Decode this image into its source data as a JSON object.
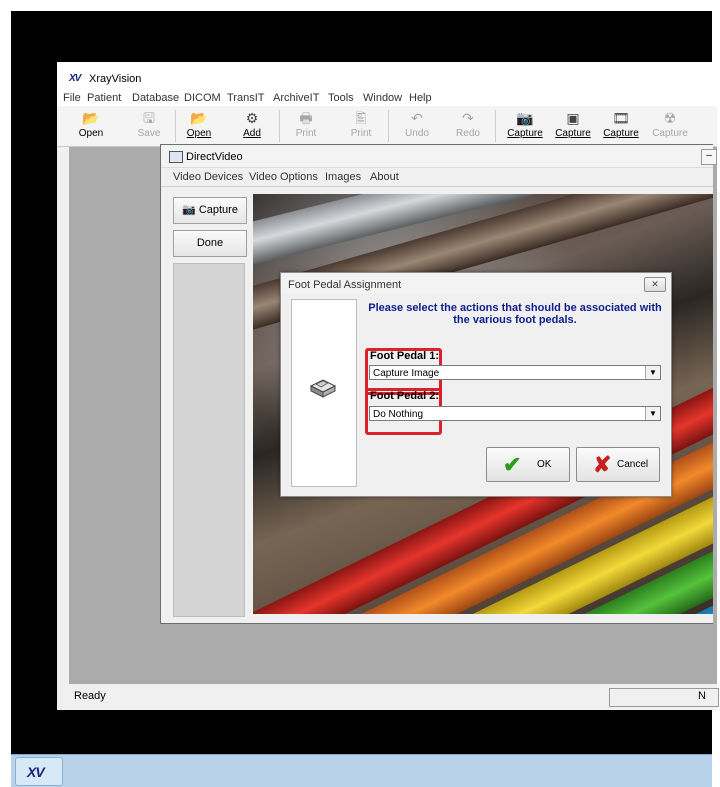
{
  "app": {
    "title": "XrayVision",
    "logo": "XV",
    "menu": [
      "File",
      "Patient",
      "Database",
      "DICOM",
      "TransIT",
      "ArchiveIT",
      "Tools",
      "Window",
      "Help"
    ],
    "toolbar": [
      {
        "label": "Open",
        "icon": "folder-open-icon",
        "enabled": true
      },
      {
        "label": "Save",
        "icon": "save-icon",
        "enabled": false
      },
      {
        "label": "Open",
        "icon": "folder-open-patient-icon",
        "enabled": true
      },
      {
        "label": "Add",
        "icon": "add-icon",
        "enabled": true
      },
      {
        "label": "Print",
        "icon": "print-icon",
        "enabled": false
      },
      {
        "label": "Print",
        "icon": "print-preview-icon",
        "enabled": false
      },
      {
        "label": "Undo",
        "icon": "undo-icon",
        "enabled": false
      },
      {
        "label": "Redo",
        "icon": "redo-icon",
        "enabled": false
      },
      {
        "label": "Capture",
        "icon": "camera-icon",
        "enabled": true
      },
      {
        "label": "Capture",
        "icon": "camera-capture-icon",
        "enabled": true
      },
      {
        "label": "Capture",
        "icon": "film-icon",
        "enabled": true
      },
      {
        "label": "Capture",
        "icon": "radiation-icon",
        "enabled": false
      }
    ],
    "status": {
      "text": "Ready",
      "pane2": "N"
    }
  },
  "direct_video": {
    "title": "DirectVideo",
    "menu": [
      "Video Devices",
      "Video Options",
      "Images",
      "About"
    ],
    "capture_label": "Capture",
    "done_label": "Done"
  },
  "dialog": {
    "title": "Foot Pedal Assignment",
    "prompt": "Please select the actions that should be associated with the various foot pedals.",
    "pedal1": {
      "label": "Foot Pedal 1:",
      "value": "Capture Image"
    },
    "pedal2": {
      "label": "Foot Pedal 2:",
      "value": "Do Nothing"
    },
    "ok_label": "OK",
    "cancel_label": "Cancel",
    "highlight_color": "#d8232a"
  },
  "taskbar": {
    "logo": "XV"
  }
}
